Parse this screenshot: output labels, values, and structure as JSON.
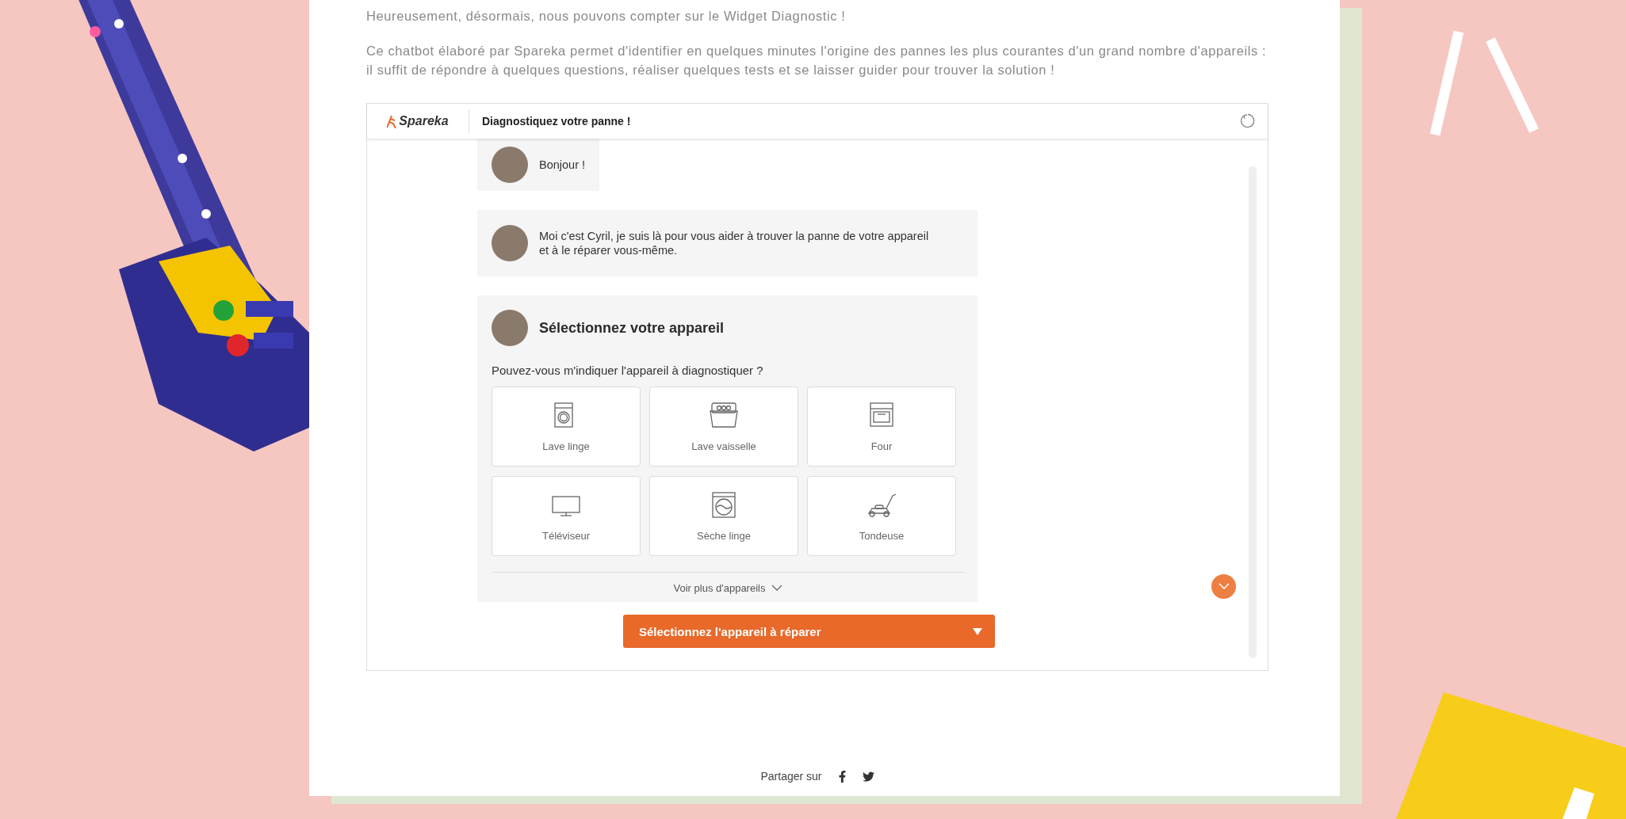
{
  "intro": [
    "Heureusement, désormais, nous pouvons compter sur le Widget Diagnostic !",
    "Ce chatbot élaboré par Spareka permet d'identifier en quelques minutes l'origine des pannes les plus courantes d'un grand nombre d'appareils : il suffit de répondre à quelques questions, réaliser quelques tests et se laisser guider pour trouver la solution !"
  ],
  "widget": {
    "brand": "Spareka",
    "title": "Diagnostiquez votre panne !",
    "messages": [
      {
        "kind": "text",
        "text": "Bonjour !"
      },
      {
        "kind": "text",
        "text": "Moi c'est Cyril, je suis là pour vous aider à trouver la panne de votre appareil et à le réparer vous-même."
      },
      {
        "kind": "choice",
        "title": "Sélectionnez votre appareil",
        "question": "Pouvez-vous m'indiquer l'appareil à diagnostiquer ?",
        "devices": [
          {
            "label": "Lave linge"
          },
          {
            "label": "Lave vaisselle"
          },
          {
            "label": "Four"
          },
          {
            "label": "Téléviseur"
          },
          {
            "label": "Sèche linge"
          },
          {
            "label": "Tondeuse"
          }
        ],
        "more": "Voir plus d'appareils"
      }
    ],
    "select": {
      "label": "Sélectionnez l'appareil à réparer"
    }
  },
  "share": {
    "label": "Partager sur"
  }
}
